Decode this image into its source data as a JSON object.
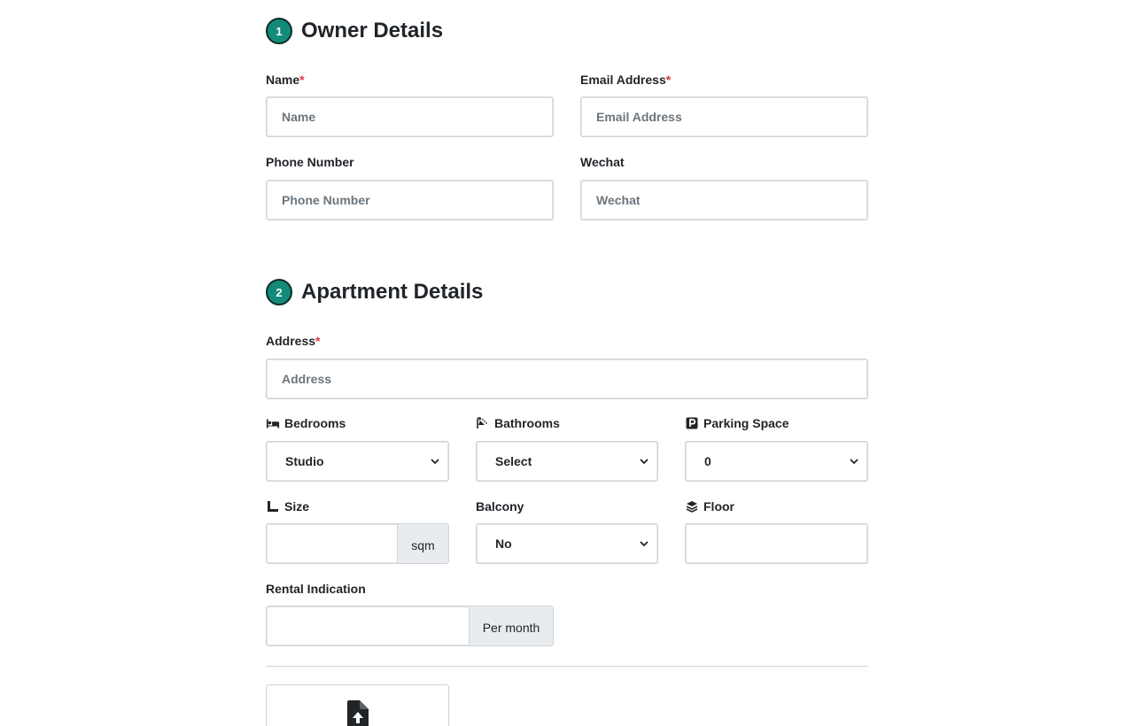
{
  "owner_section": {
    "step": "1",
    "title": "Owner Details",
    "name": {
      "label": "Name",
      "required": "*",
      "placeholder": "Name"
    },
    "email": {
      "label": "Email Address",
      "required": "*",
      "placeholder": "Email Address"
    },
    "phone": {
      "label": "Phone Number",
      "placeholder": "Phone Number"
    },
    "wechat": {
      "label": "Wechat",
      "placeholder": "Wechat"
    }
  },
  "apartment_section": {
    "step": "2",
    "title": "Apartment Details",
    "address": {
      "label": "Address",
      "required": "*",
      "placeholder": "Address"
    },
    "bedrooms": {
      "label": "Bedrooms",
      "value": "Studio",
      "icon": "bed-icon"
    },
    "bathrooms": {
      "label": "Bathrooms",
      "value": "Select",
      "icon": "shower-icon"
    },
    "parking": {
      "label": "Parking Space",
      "value": "0",
      "icon": "parking-icon"
    },
    "size": {
      "label": "Size",
      "unit": "sqm",
      "icon": "ruler-icon"
    },
    "balcony": {
      "label": "Balcony",
      "value": "No"
    },
    "floor": {
      "label": "Floor",
      "icon": "layers-icon"
    },
    "rental": {
      "label": "Rental Indication",
      "unit": "Per month"
    }
  },
  "upload": {
    "icon": "file-upload-icon"
  },
  "colors": {
    "accent": "#138a7a",
    "required": "#dc3545",
    "addon_bg": "#e9ecef"
  }
}
